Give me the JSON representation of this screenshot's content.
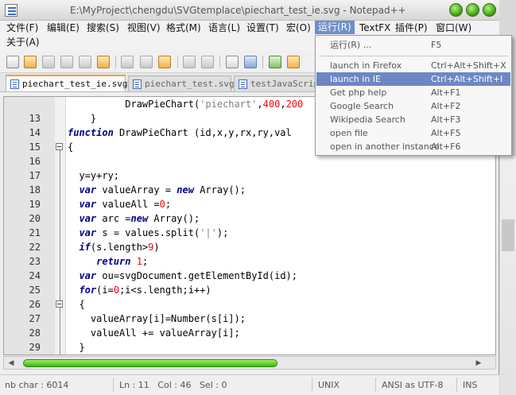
{
  "window": {
    "title": "E:\\MyProject\\chengdu\\SVGtemplace\\piechart_test_ie.svg - Notepad++"
  },
  "menubar": {
    "row1": [
      "文件(F)",
      "编辑(E)",
      "搜索(S)",
      "视图(V)",
      "格式(M)",
      "语言(L)",
      "设置(T)",
      "宏(O)",
      "运行(R)",
      "TextFX",
      "插件(P)",
      "窗口(W)"
    ],
    "row2": [
      "关于(A)"
    ]
  },
  "tabs": [
    {
      "label": "piechart_test_ie.svg",
      "active": true
    },
    {
      "label": "piechart_test.svg",
      "active": false
    },
    {
      "label": "testJavaScrip",
      "active": false
    }
  ],
  "run_menu": {
    "items": [
      {
        "label": "运行(R) ...",
        "shortcut": "F5"
      },
      {
        "label": "launch in Firefox",
        "shortcut": "Ctrl+Alt+Shift+X"
      },
      {
        "label": "launch in IE",
        "shortcut": "Ctrl+Alt+Shift+I",
        "highlighted": true
      },
      {
        "label": "Get php help",
        "shortcut": "Alt+F1"
      },
      {
        "label": "Google Search",
        "shortcut": "Alt+F2"
      },
      {
        "label": "Wikipedia Search",
        "shortcut": "Alt+F3"
      },
      {
        "label": "open file",
        "shortcut": "Alt+F5"
      },
      {
        "label": "open in another instance",
        "shortcut": "Alt+F6"
      }
    ]
  },
  "editor": {
    "lines": [
      {
        "n": "13",
        "code": "          DrawPieChart('piechart',400,200"
      },
      {
        "n": "14",
        "code": "    }"
      },
      {
        "n": "15",
        "code": "function DrawPieChart (id,x,y,rx,ry,val"
      },
      {
        "n": "16",
        "code": "{"
      },
      {
        "n": "17",
        "code": ""
      },
      {
        "n": "18",
        "code": "  y=y+ry;"
      },
      {
        "n": "19",
        "code": "  var valueArray = new Array();"
      },
      {
        "n": "20",
        "code": "  var valueAll =0;"
      },
      {
        "n": "21",
        "code": "  var arc =new Array();"
      },
      {
        "n": "22",
        "code": "  var s = values.split('|');"
      },
      {
        "n": "23",
        "code": "  if(s.length>9)"
      },
      {
        "n": "24",
        "code": "     return 1;"
      },
      {
        "n": "25",
        "code": "  var ou=svgDocument.getElementById(id);"
      },
      {
        "n": "26",
        "code": "  for(i=0;i<s.length;i++)"
      },
      {
        "n": "27",
        "code": "  {"
      },
      {
        "n": "28",
        "code": "    valueArray[i]=Number(s[i]);"
      },
      {
        "n": "29",
        "code": "    valueAll += valueArray[i];"
      },
      {
        "n": "30",
        "code": "  }"
      }
    ]
  },
  "statusbar": {
    "chars": "nb char : 6014",
    "position": "Ln : 11   Col : 46   Sel : 0",
    "eol": "UNIX",
    "encoding": "ANSI as UTF-8",
    "mode": "INS"
  },
  "colors": {
    "keyword": "#00008b",
    "string": "#808080",
    "number": "#ff0000",
    "menu_highlight": "#6d87c4",
    "active_tab_accent": "#f2a23a",
    "scroll_thumb": "#3fb414"
  },
  "icons": {
    "toolbar": [
      "new-file-icon",
      "open-file-icon",
      "save-icon",
      "save-all-icon",
      "close-icon",
      "close-all-icon",
      "cut-icon",
      "copy-icon",
      "paste-icon",
      "undo-icon",
      "redo-icon",
      "find-icon",
      "replace-icon",
      "zoom-in-icon",
      "zoom-out-icon"
    ]
  }
}
